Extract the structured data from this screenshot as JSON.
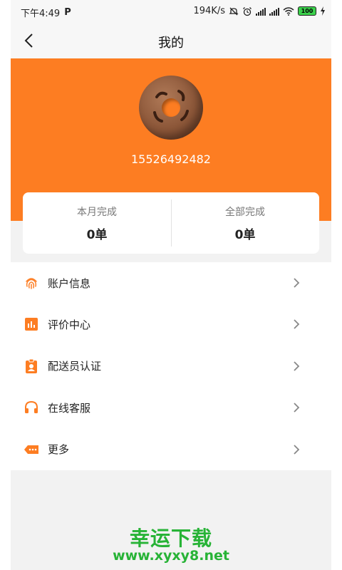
{
  "status_bar": {
    "time": "下午4:49",
    "p_icon": "P",
    "speed": "194K/s",
    "battery": "100",
    "icons": [
      "mute-icon",
      "alarm-icon",
      "signal-icon",
      "signal-icon",
      "wifi-icon",
      "battery-icon",
      "charging-icon"
    ]
  },
  "title_bar": {
    "title": "我的",
    "back_icon": "chevron-left-icon"
  },
  "profile": {
    "phone": "15526492482"
  },
  "stats": [
    {
      "label": "本月完成",
      "value": "0单"
    },
    {
      "label": "全部完成",
      "value": "0单"
    }
  ],
  "menu": [
    {
      "label": "账户信息",
      "icon": "fingerprint-icon"
    },
    {
      "label": "评价中心",
      "icon": "bar-chart-icon"
    },
    {
      "label": "配送员认证",
      "icon": "badge-icon"
    },
    {
      "label": "在线客服",
      "icon": "headset-icon"
    },
    {
      "label": "更多",
      "icon": "more-tag-icon"
    }
  ],
  "watermark": {
    "line1": "幸运下载",
    "line2": "www.xyxy8.net"
  },
  "colors": {
    "accent": "#fd7d22",
    "watermark": "#27b336",
    "background": "#f2f2f2"
  }
}
